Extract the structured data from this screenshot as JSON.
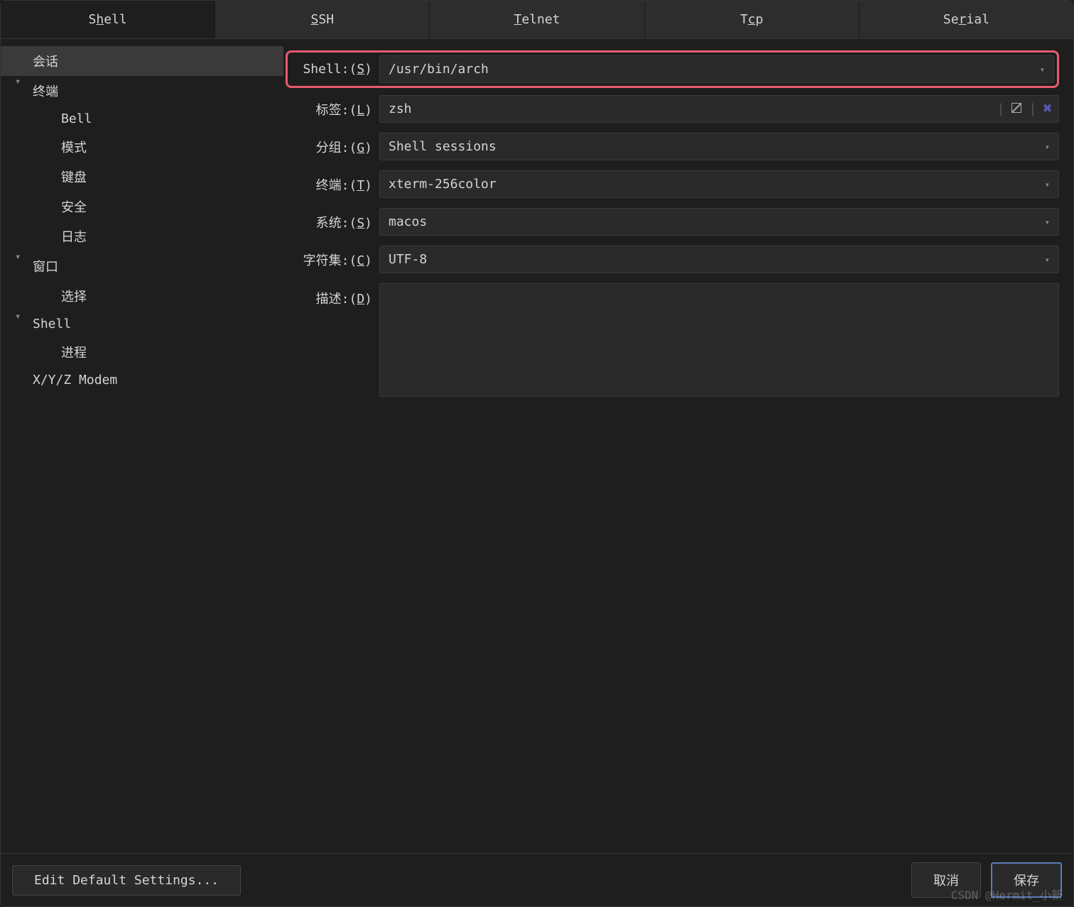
{
  "tabs": [
    {
      "pre": "S",
      "underline": "h",
      "post": "ell",
      "active": true
    },
    {
      "pre": "",
      "underline": "S",
      "post": "SH",
      "active": false
    },
    {
      "pre": "",
      "underline": "T",
      "post": "elnet",
      "active": false
    },
    {
      "pre": "T",
      "underline": "c",
      "post": "p",
      "active": false
    },
    {
      "pre": "Se",
      "underline": "r",
      "post": "ial",
      "active": false
    }
  ],
  "sidebar": {
    "items": [
      {
        "label": "会话",
        "level": 1,
        "selected": true,
        "chevron": false
      },
      {
        "label": "终端",
        "level": 1,
        "selected": false,
        "chevron": true
      },
      {
        "label": "Bell",
        "level": 2,
        "selected": false,
        "chevron": false
      },
      {
        "label": "模式",
        "level": 2,
        "selected": false,
        "chevron": false
      },
      {
        "label": "键盘",
        "level": 2,
        "selected": false,
        "chevron": false
      },
      {
        "label": "安全",
        "level": 2,
        "selected": false,
        "chevron": false
      },
      {
        "label": "日志",
        "level": 2,
        "selected": false,
        "chevron": false
      },
      {
        "label": "窗口",
        "level": 1,
        "selected": false,
        "chevron": true
      },
      {
        "label": "选择",
        "level": 2,
        "selected": false,
        "chevron": false
      },
      {
        "label": "Shell",
        "level": 1,
        "selected": false,
        "chevron": true
      },
      {
        "label": "进程",
        "level": 2,
        "selected": false,
        "chevron": false
      },
      {
        "label": "X/Y/Z Modem",
        "level": 1,
        "selected": false,
        "chevron": false
      }
    ]
  },
  "form": {
    "shell": {
      "label_pre": "Shell:(",
      "label_u": "S",
      "label_post": ")",
      "value": "/usr/bin/arch"
    },
    "label": {
      "label_pre": "标签:(",
      "label_u": "L",
      "label_post": ")",
      "value": "zsh"
    },
    "group": {
      "label_pre": "分组:(",
      "label_u": "G",
      "label_post": ")",
      "value": "Shell sessions"
    },
    "terminal": {
      "label_pre": "终端:(",
      "label_u": "T",
      "label_post": ")",
      "value": "xterm-256color"
    },
    "system": {
      "label_pre": "系统:(",
      "label_u": "S",
      "label_post": ")",
      "value": "macos"
    },
    "charset": {
      "label_pre": "字符集:(",
      "label_u": "C",
      "label_post": ")",
      "value": "UTF-8"
    },
    "description": {
      "label_pre": "描述:(",
      "label_u": "D",
      "label_post": ")",
      "value": ""
    }
  },
  "footer": {
    "edit_default": "Edit Default Settings...",
    "cancel": "取消",
    "save": "保存"
  },
  "watermark": "CSDN @Hermit_小新"
}
